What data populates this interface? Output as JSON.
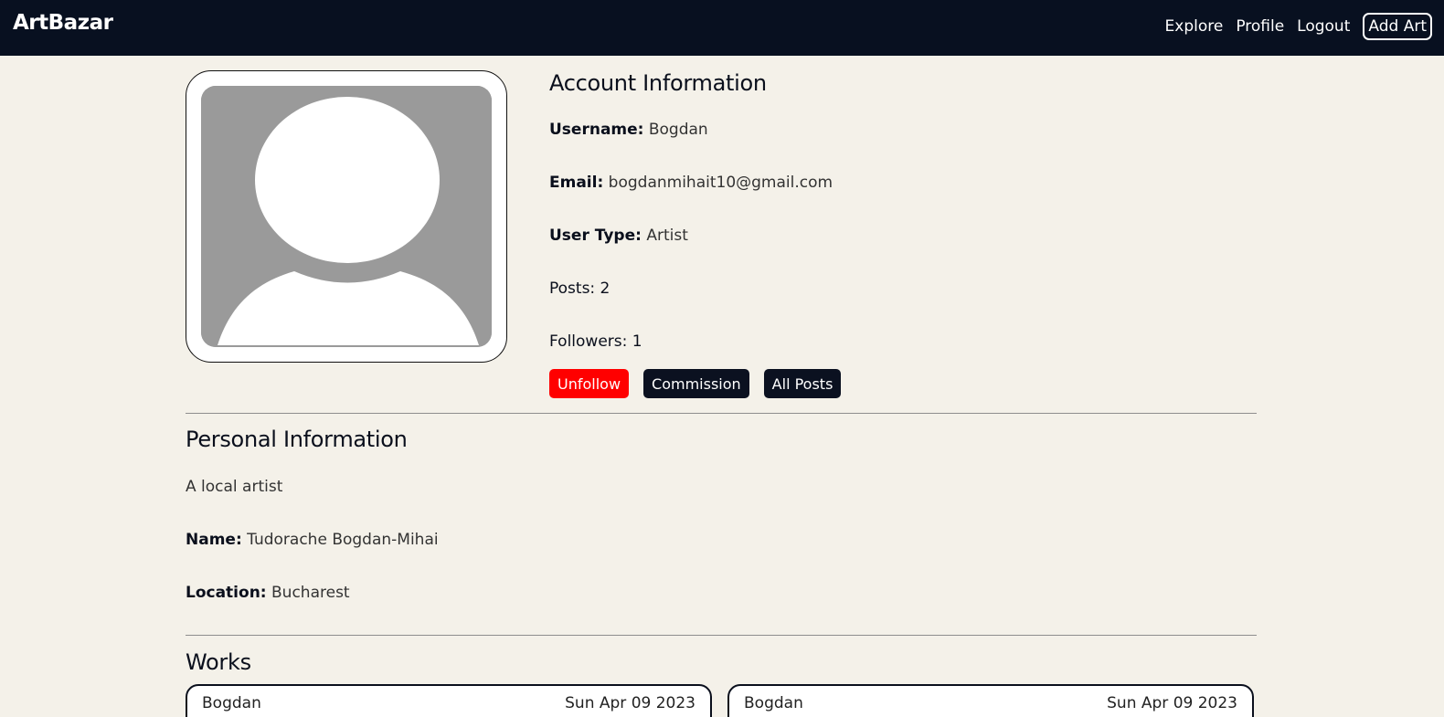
{
  "nav": {
    "brand": "ArtBazar",
    "links": [
      "Explore",
      "Profile",
      "Logout"
    ],
    "add_art": "Add Art"
  },
  "account": {
    "title": "Account Information",
    "username_label": "Username:",
    "username": "Bogdan",
    "email_label": "Email:",
    "email": "bogdanmihait10@gmail.com",
    "user_type_label": "User Type:",
    "user_type": "Artist",
    "posts": "Posts: 2",
    "followers": "Followers: 1",
    "buttons": {
      "unfollow": "Unfollow",
      "commission": "Commission",
      "all_posts": "All Posts"
    }
  },
  "personal": {
    "title": "Personal Information",
    "bio": "A local artist",
    "name_label": "Name:",
    "name": "Tudorache Bogdan-Mihai",
    "location_label": "Location:",
    "location": "Bucharest"
  },
  "works": {
    "title": "Works",
    "cards": [
      {
        "author": "Bogdan",
        "date": "Sun Apr 09 2023"
      },
      {
        "author": "Bogdan",
        "date": "Sun Apr 09 2023"
      }
    ]
  },
  "colors": {
    "navbar": "#081020",
    "background": "#f4f1e9",
    "unfollow": "#ff0000",
    "dark_button": "#0b1120"
  }
}
